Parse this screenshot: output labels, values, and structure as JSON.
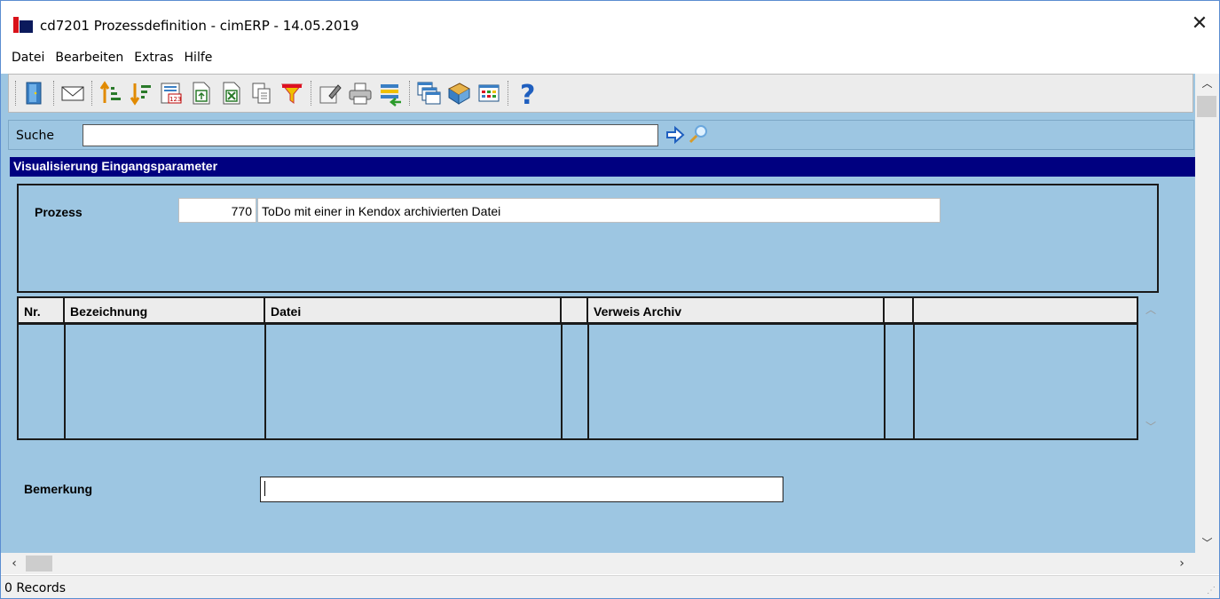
{
  "window": {
    "title": "cd7201 Prozessdefinition - cimERP - 14.05.2019",
    "close_glyph": "✕"
  },
  "menu": {
    "items": [
      "Datei",
      "Bearbeiten",
      "Extras",
      "Hilfe"
    ]
  },
  "toolbar": {
    "icons": [
      "exit-door-icon",
      "envelope-icon",
      "sort-ascending-icon",
      "sort-descending-icon",
      "calendar-123-icon",
      "export-document-icon",
      "excel-export-icon",
      "copy-documents-icon",
      "filter-funnel-icon",
      "edit-form-icon",
      "printer-icon",
      "list-import-icon",
      "windows-cascade-icon",
      "book-icon",
      "grid-view-icon",
      "help-question-icon"
    ]
  },
  "search": {
    "label": "Suche",
    "value": ""
  },
  "section": {
    "title": "Visualisierung Eingangsparameter"
  },
  "process": {
    "label": "Prozess",
    "id": "770",
    "description": "ToDo mit einer in Kendox archivierten Datei"
  },
  "grid": {
    "columns": [
      "Nr.",
      "Bezeichnung",
      "Datei",
      "",
      "Verweis Archiv",
      "",
      ""
    ],
    "rows": []
  },
  "remark": {
    "label": "Bemerkung",
    "value": ""
  },
  "status": {
    "text": "0 Records"
  },
  "colors": {
    "background": "#9dc6e2",
    "section_header": "#000080",
    "brand_red": "#d9121a",
    "brand_navy": "#0b1a5c"
  }
}
